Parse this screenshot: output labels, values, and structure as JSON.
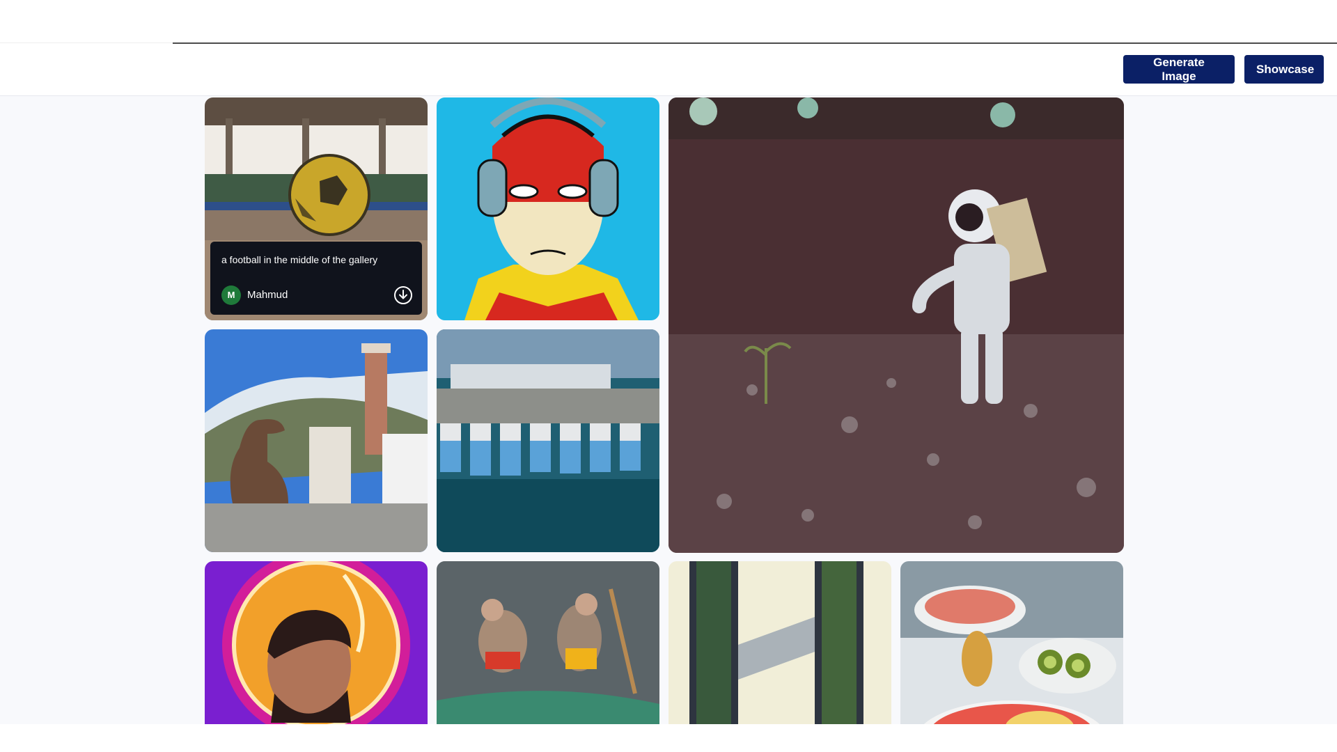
{
  "header": {
    "generate_label": "Generate Image",
    "showcase_label": "Showcase"
  },
  "gallery": {
    "featured": {
      "prompt": "a football in the middle of the gallery",
      "author": "Mahmud",
      "avatar_initial": "M"
    },
    "tiles": [
      {
        "name": "football-image"
      },
      {
        "name": "comic-hero-headphones-image"
      },
      {
        "name": "astronaut-seedling-image"
      },
      {
        "name": "dinosaur-city-image"
      },
      {
        "name": "harbor-boats-image"
      },
      {
        "name": "neon-portrait-image"
      },
      {
        "name": "mice-surfing-image"
      },
      {
        "name": "green-towers-image"
      },
      {
        "name": "fruit-bowls-image"
      }
    ]
  },
  "icons": {
    "download": "download-icon"
  },
  "colors": {
    "button_bg": "#0b2066",
    "page_bg": "#f8f9fc",
    "avatar_bg": "#1f7a3a",
    "overlay_bg": "#10131c"
  }
}
